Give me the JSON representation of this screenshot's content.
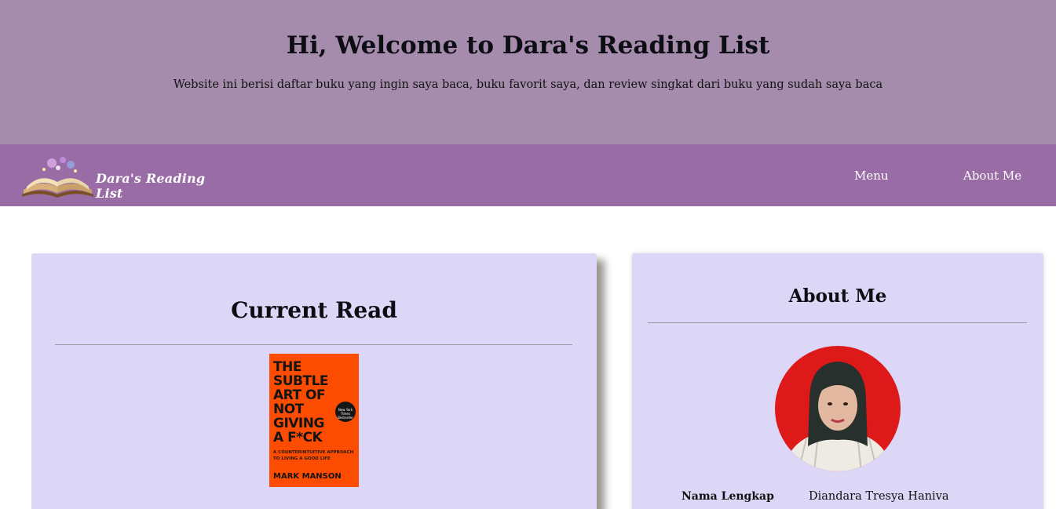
{
  "hero": {
    "title": "Hi, Welcome to Dara's Reading List",
    "subtitle": "Website ini berisi daftar buku yang ingin saya baca, buku favorit saya, dan review singkat dari buku yang sudah saya baca"
  },
  "navbar": {
    "logo_text": "Dara's Reading List",
    "links": [
      {
        "label": "Menu"
      },
      {
        "label": "About Me"
      }
    ]
  },
  "current_read": {
    "title": "Current Read",
    "book": {
      "title": "THE SUBTLE ART OF NOT GIVING A F*CK",
      "subtitle": "A COUNTERINTUITIVE APPROACH TO LIVING A GOOD LIFE",
      "author": "MARK MANSON",
      "badge": "New York Times Bestseller"
    }
  },
  "about": {
    "title": "About Me",
    "fields": [
      {
        "label": "Nama Lengkap",
        "value": "Diandara Tresya Haniva"
      }
    ]
  },
  "colors": {
    "hero_bg": "#a58bac",
    "nav_bg": "#996ca6",
    "card_bg": "#dcd6f7",
    "book_cover": "#fc4c02",
    "avatar_bg": "#de1919"
  },
  "icons": [
    "open-book-logo-icon"
  ]
}
